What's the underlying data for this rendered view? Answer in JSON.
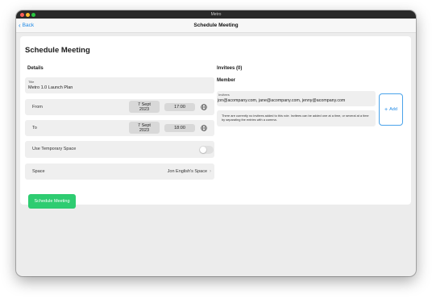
{
  "window": {
    "title": "Metro"
  },
  "navbar": {
    "back_label": "Back",
    "title": "Schedule Meeting"
  },
  "sheet": {
    "title": "Schedule Meeting"
  },
  "details": {
    "heading": "Details",
    "title_caption": "Title",
    "title_value": "Metro 1.0 Launch Plan",
    "from": {
      "label": "From",
      "date_line1": "7 Sept",
      "date_line2": "2023",
      "time": "17:00"
    },
    "to": {
      "label": "To",
      "date_line1": "7 Sept",
      "date_line2": "2023",
      "time": "18:00"
    },
    "temp_space": {
      "label": "Use Temporary Space",
      "enabled": false
    },
    "space": {
      "label": "Space",
      "value": "Jon English's Space"
    },
    "submit_label": "Schedule Meeting"
  },
  "invitees": {
    "heading": "Invitees (0)",
    "member_label": "Member",
    "field_caption": "Invitees",
    "field_value": "jon@acompany.com, jane@acompany.com, jenny@acompany.com",
    "help_text": "There are currently no invitees added to this role. Invitees can be added one at a time, or several at a time by separating the entries with a comma.",
    "add_label": "Add"
  },
  "colors": {
    "accent": "#1e88e5",
    "primary_button": "#2ecc71",
    "row_background": "#efefef"
  },
  "icons": {
    "back": "chevron-left-icon",
    "globe": "globe-icon",
    "chevron": "chevron-right-icon",
    "add": "plus-icon"
  }
}
